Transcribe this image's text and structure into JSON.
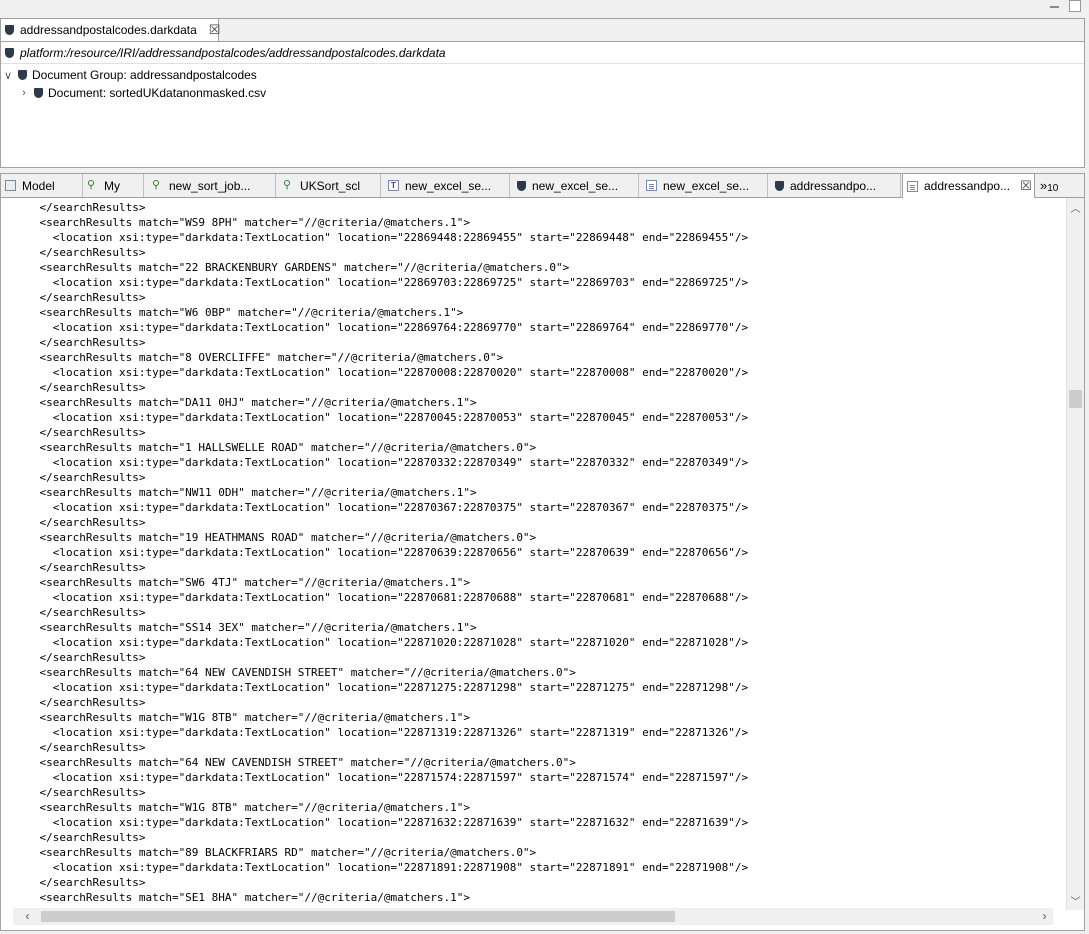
{
  "top_editor": {
    "tab_label": "addressandpostalcodes.darkdata",
    "resource_path": "platform:/resource/IRI/addressandpostalcodes/addressandpostalcodes.darkdata",
    "tree": {
      "group": "Document Group: addressandpostalcodes",
      "document": "Document: sortedUKdatanonmasked.csv"
    }
  },
  "tabs": [
    {
      "label": "Model",
      "icon": "model-icon"
    },
    {
      "label": "My",
      "icon": "tree-icon"
    },
    {
      "label": "new_sort_job...",
      "icon": "tree-icon"
    },
    {
      "label": "UKSort_scl",
      "icon": "tree-icon"
    },
    {
      "label": "new_excel_se...",
      "icon": "text-file-icon"
    },
    {
      "label": "new_excel_se...",
      "icon": "darkdata-icon"
    },
    {
      "label": "new_excel_se...",
      "icon": "document-icon"
    },
    {
      "label": "addressandpo...",
      "icon": "darkdata-icon"
    },
    {
      "label": "addressandpo...",
      "icon": "document-icon"
    }
  ],
  "tab_overflow": {
    "symbol": "»",
    "count": "10"
  },
  "code_lines": [
    "    </searchResults>",
    "    <searchResults match=\"WS9 8PH\" matcher=\"//@criteria/@matchers.1\">",
    "      <location xsi:type=\"darkdata:TextLocation\" location=\"22869448:22869455\" start=\"22869448\" end=\"22869455\"/>",
    "    </searchResults>",
    "    <searchResults match=\"22 BRACKENBURY GARDENS\" matcher=\"//@criteria/@matchers.0\">",
    "      <location xsi:type=\"darkdata:TextLocation\" location=\"22869703:22869725\" start=\"22869703\" end=\"22869725\"/>",
    "    </searchResults>",
    "    <searchResults match=\"W6 0BP\" matcher=\"//@criteria/@matchers.1\">",
    "      <location xsi:type=\"darkdata:TextLocation\" location=\"22869764:22869770\" start=\"22869764\" end=\"22869770\"/>",
    "    </searchResults>",
    "    <searchResults match=\"8 OVERCLIFFE\" matcher=\"//@criteria/@matchers.0\">",
    "      <location xsi:type=\"darkdata:TextLocation\" location=\"22870008:22870020\" start=\"22870008\" end=\"22870020\"/>",
    "    </searchResults>",
    "    <searchResults match=\"DA11 0HJ\" matcher=\"//@criteria/@matchers.1\">",
    "      <location xsi:type=\"darkdata:TextLocation\" location=\"22870045:22870053\" start=\"22870045\" end=\"22870053\"/>",
    "    </searchResults>",
    "    <searchResults match=\"1 HALLSWELLE ROAD\" matcher=\"//@criteria/@matchers.0\">",
    "      <location xsi:type=\"darkdata:TextLocation\" location=\"22870332:22870349\" start=\"22870332\" end=\"22870349\"/>",
    "    </searchResults>",
    "    <searchResults match=\"NW11 0DH\" matcher=\"//@criteria/@matchers.1\">",
    "      <location xsi:type=\"darkdata:TextLocation\" location=\"22870367:22870375\" start=\"22870367\" end=\"22870375\"/>",
    "    </searchResults>",
    "    <searchResults match=\"19 HEATHMANS ROAD\" matcher=\"//@criteria/@matchers.0\">",
    "      <location xsi:type=\"darkdata:TextLocation\" location=\"22870639:22870656\" start=\"22870639\" end=\"22870656\"/>",
    "    </searchResults>",
    "    <searchResults match=\"SW6 4TJ\" matcher=\"//@criteria/@matchers.1\">",
    "      <location xsi:type=\"darkdata:TextLocation\" location=\"22870681:22870688\" start=\"22870681\" end=\"22870688\"/>",
    "    </searchResults>",
    "    <searchResults match=\"SS14 3EX\" matcher=\"//@criteria/@matchers.1\">",
    "      <location xsi:type=\"darkdata:TextLocation\" location=\"22871020:22871028\" start=\"22871020\" end=\"22871028\"/>",
    "    </searchResults>",
    "    <searchResults match=\"64 NEW CAVENDISH STREET\" matcher=\"//@criteria/@matchers.0\">",
    "      <location xsi:type=\"darkdata:TextLocation\" location=\"22871275:22871298\" start=\"22871275\" end=\"22871298\"/>",
    "    </searchResults>",
    "    <searchResults match=\"W1G 8TB\" matcher=\"//@criteria/@matchers.1\">",
    "      <location xsi:type=\"darkdata:TextLocation\" location=\"22871319:22871326\" start=\"22871319\" end=\"22871326\"/>",
    "    </searchResults>",
    "    <searchResults match=\"64 NEW CAVENDISH STREET\" matcher=\"//@criteria/@matchers.0\">",
    "      <location xsi:type=\"darkdata:TextLocation\" location=\"22871574:22871597\" start=\"22871574\" end=\"22871597\"/>",
    "    </searchResults>",
    "    <searchResults match=\"W1G 8TB\" matcher=\"//@criteria/@matchers.1\">",
    "      <location xsi:type=\"darkdata:TextLocation\" location=\"22871632:22871639\" start=\"22871632\" end=\"22871639\"/>",
    "    </searchResults>",
    "    <searchResults match=\"89 BLACKFRIARS RD\" matcher=\"//@criteria/@matchers.0\">",
    "      <location xsi:type=\"darkdata:TextLocation\" location=\"22871891:22871908\" start=\"22871891\" end=\"22871908\"/>",
    "    </searchResults>",
    "    <searchResults match=\"SE1 8HA\" matcher=\"//@criteria/@matchers.1\">"
  ]
}
